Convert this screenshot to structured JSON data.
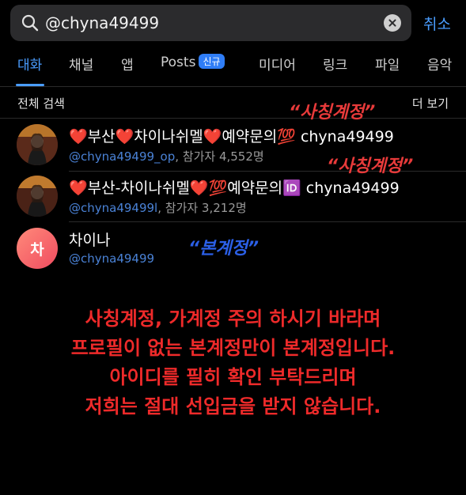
{
  "search": {
    "query": "@chyna49499",
    "cancel_label": "취소"
  },
  "tabs": [
    {
      "label": "대화",
      "active": true
    },
    {
      "label": "채널"
    },
    {
      "label": "앱"
    },
    {
      "label": "Posts",
      "badge": "신규"
    },
    {
      "label": "미디어"
    },
    {
      "label": "링크"
    },
    {
      "label": "파일"
    },
    {
      "label": "음악"
    }
  ],
  "section": {
    "title": "전체 검색",
    "more": "더 보기"
  },
  "results": [
    {
      "title": "❤️부산❤️차이나쉬멜❤️예약문의💯 chyna49499",
      "handle": "@chyna49499_op",
      "meta": ", 참가자 4,552명"
    },
    {
      "title": "❤️부산-차이나쉬멜❤️💯예약문의🆔 chyna49499",
      "handle": "@chyna49499l",
      "meta": ", 참가자 3,212명"
    },
    {
      "title": "차이나",
      "handle": "@chyna49499",
      "avatar_letter": "차"
    }
  ],
  "labels": {
    "fake1": "“사칭계정”",
    "fake2": "“사칭계정”",
    "real": "“본계정”"
  },
  "notice": [
    "사칭계정, 가계정 주의 하시기 바라며",
    "프로필이 없는 본계정만이 본계정입니다.",
    "아이디를 필히 확인 부탁드리며",
    "저희는 절대 선입금을 받지 않습니다."
  ],
  "colors": {
    "accent": "#4a9dff",
    "warning": "#ee2a2a",
    "real_label": "#2b5fe6"
  }
}
